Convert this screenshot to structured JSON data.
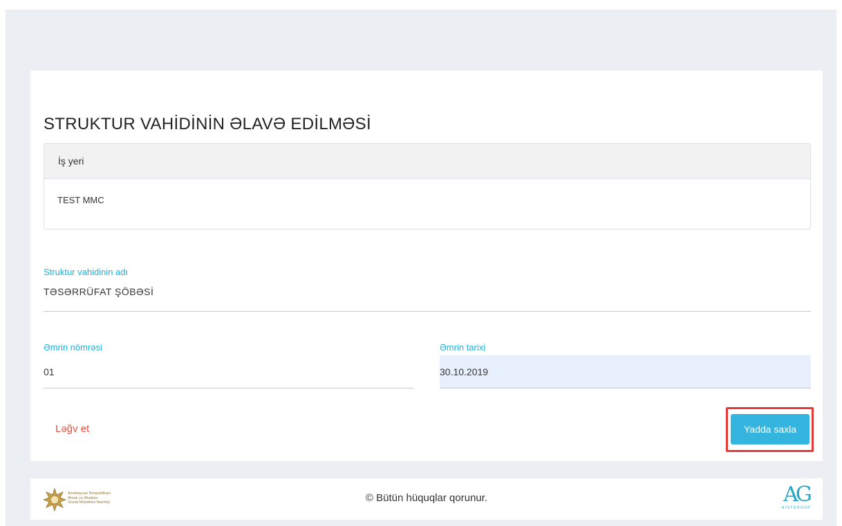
{
  "page": {
    "title": "STRUKTUR VAHİDİNİN ƏLAVƏ EDİLMƏSİ"
  },
  "workplace": {
    "header": "İş yeri",
    "value": "TEST MMC"
  },
  "form": {
    "name_label": "Struktur vahidinin adı",
    "name_value": "TƏSƏRRÜFAT ŞÖBƏSİ",
    "order_number_label": "Əmrin nömrəsi",
    "order_number_value": "01",
    "order_date_label": "Əmrin tarixi",
    "order_date_value": "30.10.2019"
  },
  "actions": {
    "cancel_label": "Ləğv et",
    "save_label": "Yadda saxla"
  },
  "footer": {
    "copyright": "© Bütün hüquqlar qorunur.",
    "ministry_lines": [
      "Azərbaycan Respublikası",
      "Əmək və Əhalinin",
      "Sosial Müdafiəsi Nazirliyi"
    ],
    "brand_mark": "AG",
    "brand_name": "AISTGROUP"
  },
  "colors": {
    "accent": "#1ab2dc",
    "button": "#34b5df",
    "danger": "#e74c3c",
    "highlight": "#e53935",
    "background": "#ebeef2"
  }
}
